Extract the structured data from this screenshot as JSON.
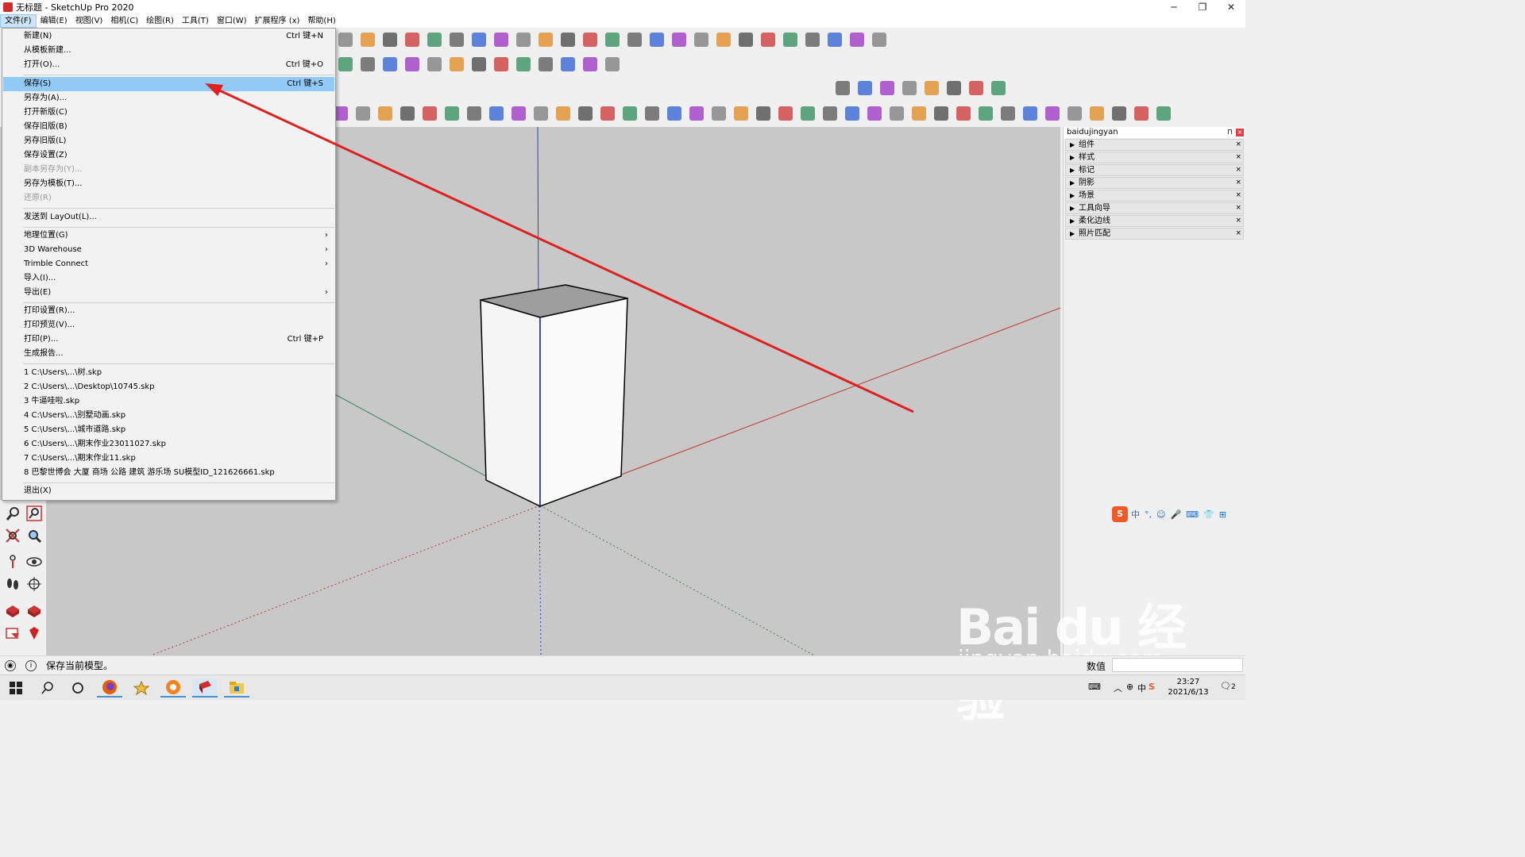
{
  "window": {
    "title": "无标题 - SketchUp Pro 2020",
    "minimize": "─",
    "maximize": "❐",
    "close": "✕"
  },
  "menubar": {
    "items": [
      "文件(F)",
      "编辑(E)",
      "视图(V)",
      "相机(C)",
      "绘图(R)",
      "工具(T)",
      "窗口(W)",
      "扩展程序 (x)",
      "帮助(H)"
    ]
  },
  "file_menu": {
    "items": [
      {
        "label": "新建(N)",
        "shortcut": "Ctrl 键+N"
      },
      {
        "label": "从模板新建...",
        "shortcut": ""
      },
      {
        "label": "打开(O)...",
        "shortcut": "Ctrl 键+O"
      },
      {
        "label": "保存(S)",
        "shortcut": "Ctrl 键+S"
      },
      {
        "label": "另存为(A)...",
        "shortcut": ""
      },
      {
        "label": "打开新版(C)",
        "shortcut": ""
      },
      {
        "label": "保存旧版(B)",
        "shortcut": ""
      },
      {
        "label": "另存旧版(L)",
        "shortcut": ""
      },
      {
        "label": "保存设置(Z)",
        "shortcut": ""
      },
      {
        "label": "副本另存为(Y)...",
        "shortcut": ""
      },
      {
        "label": "另存为模板(T)...",
        "shortcut": ""
      },
      {
        "label": "还原(R)",
        "shortcut": ""
      },
      {
        "label": "发送到 LayOut(L)...",
        "shortcut": ""
      },
      {
        "label": "地理位置(G)",
        "shortcut": "›"
      },
      {
        "label": "3D Warehouse",
        "shortcut": "›"
      },
      {
        "label": "Trimble Connect",
        "shortcut": "›"
      },
      {
        "label": "导入(I)...",
        "shortcut": ""
      },
      {
        "label": "导出(E)",
        "shortcut": "›"
      },
      {
        "label": "打印设置(R)...",
        "shortcut": ""
      },
      {
        "label": "打印预览(V)...",
        "shortcut": ""
      },
      {
        "label": "打印(P)...",
        "shortcut": "Ctrl 键+P"
      },
      {
        "label": "生成报告...",
        "shortcut": ""
      },
      {
        "label": "1 C:\\Users\\...\\树.skp",
        "shortcut": ""
      },
      {
        "label": "2 C:\\Users\\...\\Desktop\\10745.skp",
        "shortcut": ""
      },
      {
        "label": "3 牛逼哇啦.skp",
        "shortcut": ""
      },
      {
        "label": "4 C:\\Users\\...\\别墅动画.skp",
        "shortcut": ""
      },
      {
        "label": "5 C:\\Users\\...\\城市道路.skp",
        "shortcut": ""
      },
      {
        "label": "6 C:\\Users\\...\\期末作业23011027.skp",
        "shortcut": ""
      },
      {
        "label": "7 C:\\Users\\...\\期末作业11.skp",
        "shortcut": ""
      },
      {
        "label": "8 巴黎世博会 大厦 商场 公路 建筑 游乐场 SU模型ID_121626661.skp",
        "shortcut": ""
      },
      {
        "label": "退出(X)",
        "shortcut": ""
      }
    ]
  },
  "tray": {
    "title": "baidujingyan",
    "pin": "⊓",
    "close": "×",
    "panels": [
      "组件",
      "样式",
      "标记",
      "阴影",
      "场景",
      "工具向导",
      "柔化边线",
      "照片匹配"
    ]
  },
  "ime": {
    "logo": "S",
    "items": [
      "中",
      "°,",
      "☺",
      "🎤",
      "⌨",
      "👕",
      "⊞"
    ]
  },
  "watermark": {
    "main": "Bai du 经验",
    "sub": "jingyan.baidu.com"
  },
  "statusbar": {
    "message": "保存当前模型。",
    "measure_label": "数值"
  },
  "taskbar": {
    "time": "23:27",
    "date": "2021/6/13",
    "ime_indicator": "中",
    "notif": "2"
  },
  "colors": {
    "menu_highlight": "#91c9f7",
    "axis_red": "#c0392b",
    "axis_green": "#2e8b57",
    "axis_blue": "#2b3fd1",
    "annotation_arrow": "#e02020",
    "viewport_bg": "#c8c8c8"
  }
}
